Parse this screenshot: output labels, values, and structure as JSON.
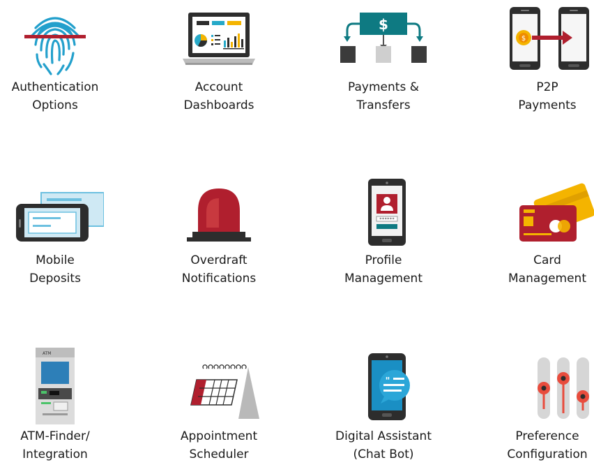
{
  "features": [
    {
      "line1": "Authentication",
      "line2": "Options",
      "icon": "fingerprint-icon"
    },
    {
      "line1": "Account",
      "line2": "Dashboards",
      "icon": "laptop-dashboard-icon"
    },
    {
      "line1": "Payments &",
      "line2": "Transfers",
      "icon": "money-transfer-icon"
    },
    {
      "line1": "P2P",
      "line2": "Payments",
      "icon": "phone-to-phone-icon"
    },
    {
      "line1": "Mobile",
      "line2": "Deposits",
      "icon": "mobile-check-deposit-icon"
    },
    {
      "line1": "Overdraft",
      "line2": "Notifications",
      "icon": "alarm-siren-icon"
    },
    {
      "line1": "Profile",
      "line2": "Management",
      "icon": "phone-profile-icon"
    },
    {
      "line1": "Card",
      "line2": "Management",
      "icon": "credit-cards-icon"
    },
    {
      "line1": "ATM-Finder/",
      "line2": "Integration",
      "icon": "atm-machine-icon"
    },
    {
      "line1": "Appointment",
      "line2": "Scheduler",
      "icon": "calendar-icon"
    },
    {
      "line1": "Digital Assistant",
      "line2": "(Chat Bot)",
      "icon": "chat-bot-phone-icon"
    },
    {
      "line1": "Preference",
      "line2": "Configuration",
      "icon": "sliders-icon"
    }
  ],
  "atm_label": "ATM",
  "colors": {
    "red": "#b01f2e",
    "teal": "#0e7a82",
    "blue": "#1a8fc4",
    "dark": "#2d2d2d"
  }
}
